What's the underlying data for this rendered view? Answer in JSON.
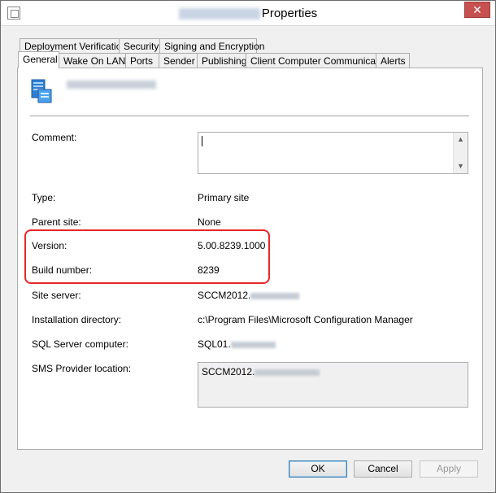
{
  "window": {
    "title_suffix": "Properties"
  },
  "tabs_row1": [
    {
      "label": "Deployment Verification"
    },
    {
      "label": "Security"
    },
    {
      "label": "Signing and Encryption"
    }
  ],
  "tabs_row2": [
    {
      "label": "General",
      "active": true
    },
    {
      "label": "Wake On LAN"
    },
    {
      "label": "Ports"
    },
    {
      "label": "Sender"
    },
    {
      "label": "Publishing"
    },
    {
      "label": "Client Computer Communication"
    },
    {
      "label": "Alerts"
    }
  ],
  "general": {
    "comment_label": "Comment:",
    "comment_value": "",
    "type_label": "Type:",
    "type_value": "Primary site",
    "parent_label": "Parent site:",
    "parent_value": "None",
    "version_label": "Version:",
    "version_value": "5.00.8239.1000",
    "build_label": "Build number:",
    "build_value": "8239",
    "server_label": "Site server:",
    "server_value": "SCCM2012.",
    "install_label": "Installation directory:",
    "install_value": "c:\\Program Files\\Microsoft Configuration Manager",
    "sql_label": "SQL Server computer:",
    "sql_value": "SQL01.",
    "sms_label": "SMS Provider location:",
    "sms_value": "SCCM2012."
  },
  "buttons": {
    "ok": "OK",
    "cancel": "Cancel",
    "apply": "Apply"
  },
  "icons": {
    "close": "close-icon",
    "app": "window-icon",
    "site": "server-site-icon"
  },
  "colors": {
    "highlight": "#e8262a",
    "close_button": "#c75050"
  }
}
